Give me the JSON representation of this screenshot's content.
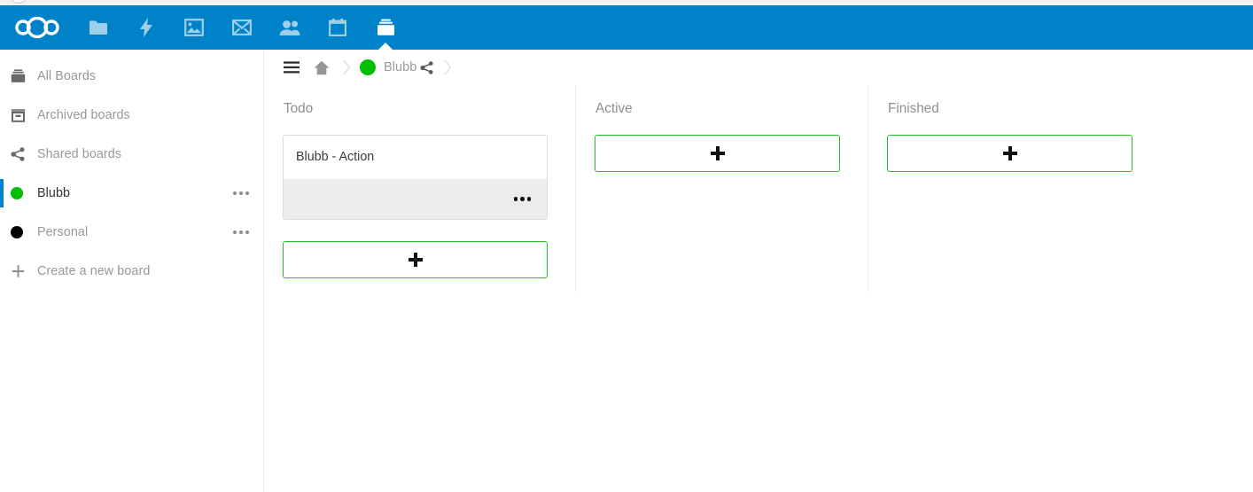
{
  "theme": {
    "header_blue": "#0082c9",
    "accent_green": "#00c000",
    "add_button_green": "#20c020",
    "card_footer_gray": "#ececec",
    "muted_text": "#989898"
  },
  "header": {
    "logo_name": "nextcloud-logo",
    "apps": [
      {
        "name": "files-app-icon",
        "label": "Files",
        "active": false
      },
      {
        "name": "activity-app-icon",
        "label": "Activity",
        "active": false
      },
      {
        "name": "photos-app-icon",
        "label": "Photos",
        "active": false
      },
      {
        "name": "mail-app-icon",
        "label": "Mail",
        "active": false
      },
      {
        "name": "contacts-app-icon",
        "label": "Contacts",
        "active": false
      },
      {
        "name": "calendar-app-icon",
        "label": "Calendar",
        "active": false
      },
      {
        "name": "deck-app-icon",
        "label": "Deck",
        "active": true
      }
    ]
  },
  "sidebar": {
    "items": [
      {
        "label": "All Boards",
        "icon": "deck-icon",
        "type": "nav",
        "active": false
      },
      {
        "label": "Archived boards",
        "icon": "archive-icon",
        "type": "nav",
        "active": false
      },
      {
        "label": "Shared boards",
        "icon": "share-icon",
        "type": "nav",
        "active": false
      },
      {
        "label": "Blubb",
        "icon": "board-dot",
        "color": "#00c000",
        "type": "board",
        "active": true,
        "menu": "..."
      },
      {
        "label": "Personal",
        "icon": "board-dot",
        "color": "#000000",
        "type": "board",
        "active": false,
        "menu": "..."
      },
      {
        "label": "Create a new board",
        "icon": "plus-icon",
        "type": "action",
        "active": false
      }
    ]
  },
  "breadcrumb": {
    "menu_toggle": "hamburger-icon",
    "home": "home-icon",
    "board_name": "Blubb",
    "board_color": "#00c000",
    "share": "share-icon"
  },
  "board": {
    "stacks": [
      {
        "title": "Todo",
        "cards": [
          {
            "title": "Blubb - Action",
            "menu": "..."
          }
        ],
        "add_label": "+"
      },
      {
        "title": "Active",
        "cards": [],
        "add_label": "+"
      },
      {
        "title": "Finished",
        "cards": [],
        "add_label": "+"
      }
    ]
  }
}
